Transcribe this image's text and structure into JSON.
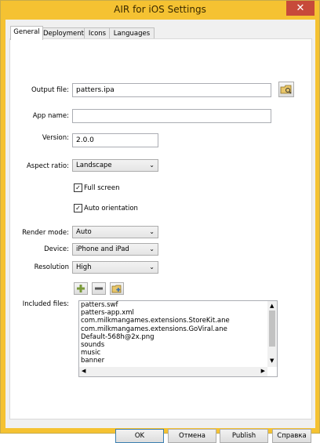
{
  "window": {
    "title": "AIR for iOS Settings",
    "close_glyph": "✕"
  },
  "tabs": [
    "General",
    "Deployment",
    "Icons",
    "Languages"
  ],
  "general": {
    "output_file": {
      "label": "Output file:",
      "value": "patters.ipa"
    },
    "app_name": {
      "label": "App name:",
      "value": ""
    },
    "version": {
      "label": "Version:",
      "value": "2.0.0"
    },
    "aspect_ratio": {
      "label": "Aspect ratio:",
      "value": "Landscape"
    },
    "full_screen": {
      "label": "Full screen",
      "checked": true
    },
    "auto_orientation": {
      "label": "Auto orientation",
      "checked": true
    },
    "render_mode": {
      "label": "Render mode:",
      "value": "Auto"
    },
    "device": {
      "label": "Device:",
      "value": "iPhone and iPad"
    },
    "resolution": {
      "label": "Resolution",
      "value": "High"
    },
    "included_files": {
      "label": "Included files:",
      "items": [
        "patters.swf",
        "patters-app.xml",
        "com.milkmangames.extensions.StoreKit.ane",
        "com.milkmangames.extensions.GoViral.ane",
        "Default-568h@2x.png",
        "sounds",
        "music",
        "banner"
      ]
    }
  },
  "icons": {
    "browse": "folder-browse-icon",
    "add": "plus-icon",
    "remove": "minus-icon",
    "add_folder": "folder-add-icon"
  },
  "buttons": {
    "ok": "OK",
    "cancel": "Отмена",
    "publish": "Publish",
    "help": "Справка"
  },
  "colors": {
    "titlebar": "#f5c232",
    "close": "#c74a3a",
    "tab_selected": "#ffffff"
  }
}
